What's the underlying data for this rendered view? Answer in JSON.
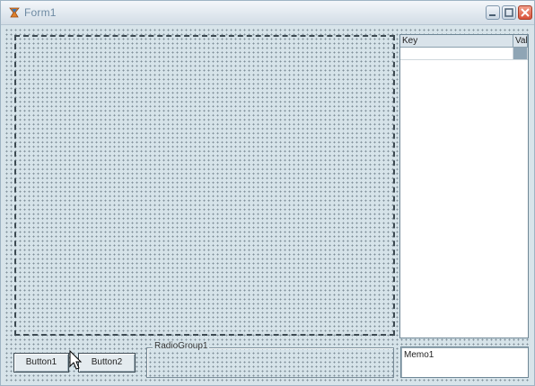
{
  "window": {
    "title": "Form1"
  },
  "titlebar": {
    "buttons": [
      {
        "name": "minimize",
        "icon": "minimize-icon"
      },
      {
        "name": "maximize",
        "icon": "maximize-icon"
      },
      {
        "name": "close",
        "icon": "close-icon"
      }
    ]
  },
  "value_list": {
    "columns": [
      "Key",
      "Val"
    ],
    "rows": [
      {
        "key": "",
        "value": ""
      }
    ]
  },
  "buttons": {
    "button1_label": "Button1",
    "button2_label": "Button2"
  },
  "radio_group": {
    "caption": "RadioGroup1"
  },
  "memo": {
    "text": "Memo1"
  },
  "colors": {
    "form_background": "#d6e3e9",
    "close_button": "#d8523a",
    "grid_selection": "#8fa5b5"
  }
}
